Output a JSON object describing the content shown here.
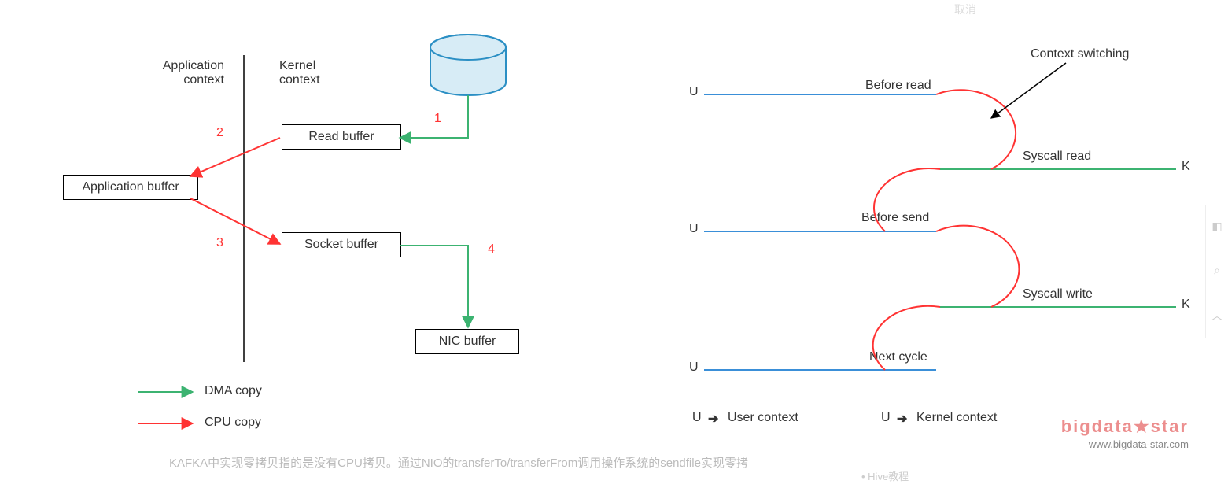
{
  "left": {
    "colA": "Application\ncontext",
    "colB": "Kernel\ncontext",
    "appBuffer": "Application buffer",
    "readBuffer": "Read buffer",
    "socketBuffer": "Socket buffer",
    "nicBuffer": "NIC buffer",
    "n1": "1",
    "n2": "2",
    "n3": "3",
    "n4": "4",
    "dma": "DMA copy",
    "cpu": "CPU copy"
  },
  "right": {
    "contextSwitching": "Context switching",
    "beforeRead": "Before read",
    "syscallRead": "Syscall read",
    "beforeSend": "Before send",
    "syscallWrite": "Syscall write",
    "nextCycle": "Next cycle",
    "U": "U",
    "K": "K",
    "legendUser": "User context",
    "legendKernel": "Kernel context",
    "arrowGlyph": "➔"
  },
  "footer": {
    "caption": "KAFKA中实现零拷贝指的是没有CPU拷贝。通过NIO的transferTo/transferFrom调用操作系统的sendfile实现零拷",
    "sidebarItem": "Hive教程",
    "watermarkBrand": "bigdata★star",
    "watermarkUrl": "www.bigdata-star.com",
    "topFaint": "取消"
  },
  "colors": {
    "green": "#3cb371",
    "red": "#f33",
    "blue": "#3a8fd8",
    "diskFill": "#d7ecf6",
    "diskStroke": "#2b8fc4",
    "black": "#000"
  }
}
